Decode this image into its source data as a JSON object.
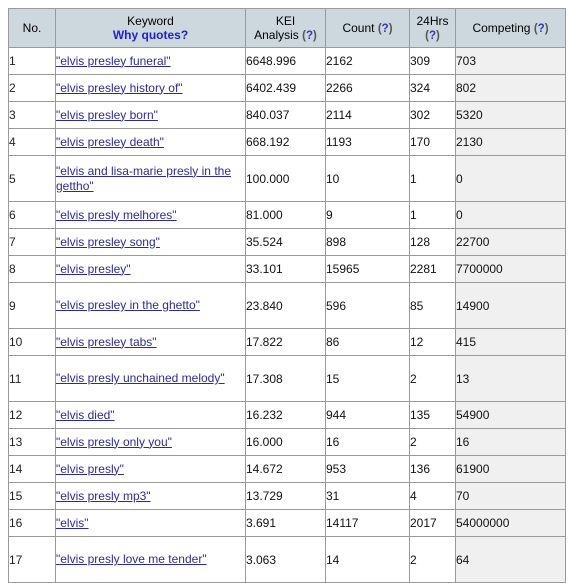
{
  "table": {
    "columns": [
      {
        "key": "no",
        "line1": "No.",
        "line2": "",
        "help": ""
      },
      {
        "key": "keyword",
        "line1": "Keyword",
        "line2": "Why quotes?",
        "help": ""
      },
      {
        "key": "kei",
        "line1": "KEI",
        "line2": "Analysis",
        "help": "(?)"
      },
      {
        "key": "count",
        "line1": "Count",
        "line2": "",
        "help": "(?)"
      },
      {
        "key": "hrs24",
        "line1": "24Hrs",
        "line2": "",
        "help": "(?)"
      },
      {
        "key": "competing",
        "line1": "Competing",
        "line2": "",
        "help": "(?)"
      }
    ],
    "rows": [
      {
        "no": "1",
        "keyword": "\"elvis presley funeral\"",
        "kei": "6648.996",
        "count": "2162",
        "hrs24": "309",
        "competing": "703"
      },
      {
        "no": "2",
        "keyword": "\"elvis presley history of\"",
        "kei": "6402.439",
        "count": "2266",
        "hrs24": "324",
        "competing": "802"
      },
      {
        "no": "3",
        "keyword": "\"elvis presley born\"",
        "kei": "840.037",
        "count": "2114",
        "hrs24": "302",
        "competing": "5320"
      },
      {
        "no": "4",
        "keyword": "\"elvis presley death\"",
        "kei": "668.192",
        "count": "1193",
        "hrs24": "170",
        "competing": "2130"
      },
      {
        "no": "5",
        "keyword": "\"elvis and lisa-marie presly in the gettho\"",
        "kei": "100.000",
        "count": "10",
        "hrs24": "1",
        "competing": "0"
      },
      {
        "no": "6",
        "keyword": "\"elvis presly melhores\"",
        "kei": "81.000",
        "count": "9",
        "hrs24": "1",
        "competing": "0"
      },
      {
        "no": "7",
        "keyword": "\"elvis presley song\"",
        "kei": "35.524",
        "count": "898",
        "hrs24": "128",
        "competing": "22700"
      },
      {
        "no": "8",
        "keyword": "\"elvis presley\"",
        "kei": "33.101",
        "count": "15965",
        "hrs24": "2281",
        "competing": "7700000"
      },
      {
        "no": "9",
        "keyword": "\"elvis presley in the ghetto\"",
        "kei": "23.840",
        "count": "596",
        "hrs24": "85",
        "competing": "14900"
      },
      {
        "no": "10",
        "keyword": "\"elvis presley tabs\"",
        "kei": "17.822",
        "count": "86",
        "hrs24": "12",
        "competing": "415"
      },
      {
        "no": "11",
        "keyword": "\"elvis presly unchained melody\"",
        "kei": "17.308",
        "count": "15",
        "hrs24": "2",
        "competing": "13"
      },
      {
        "no": "12",
        "keyword": "\"elvis died\"",
        "kei": "16.232",
        "count": "944",
        "hrs24": "135",
        "competing": "54900"
      },
      {
        "no": "13",
        "keyword": "\"elvis presly only you\"",
        "kei": "16.000",
        "count": "16",
        "hrs24": "2",
        "competing": "16"
      },
      {
        "no": "14",
        "keyword": "\"elvis presly\"",
        "kei": "14.672",
        "count": "953",
        "hrs24": "136",
        "competing": "61900"
      },
      {
        "no": "15",
        "keyword": "\"elvis presly mp3\"",
        "kei": "13.729",
        "count": "31",
        "hrs24": "4",
        "competing": "70"
      },
      {
        "no": "16",
        "keyword": "\"elvis\"",
        "kei": "3.691",
        "count": "14117",
        "hrs24": "2017",
        "competing": "54000000"
      },
      {
        "no": "17",
        "keyword": "\"elvis presly love me tender\"",
        "kei": "3.063",
        "count": "14",
        "hrs24": "2",
        "competing": "64"
      }
    ]
  },
  "colors": {
    "header_bg": "#ccd8de",
    "link": "#2b2b9e",
    "accent_blue": "#2222cc",
    "competing_bg": "#f0f0f0",
    "border": "#9a9a9a"
  }
}
